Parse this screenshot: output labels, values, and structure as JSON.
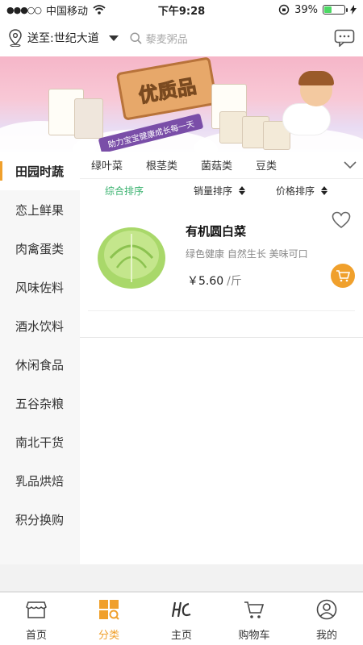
{
  "status_bar": {
    "carrier": "中国移动",
    "time": "下午9:28",
    "battery_pct": "39%",
    "battery_level": 0.39
  },
  "header": {
    "deliver_to": "送至:世纪大道",
    "search_placeholder": "藜麦粥品"
  },
  "banner": {
    "sign_text": "优质品",
    "ribbon_text": "助力宝宝健康成长每一天"
  },
  "categories": [
    {
      "label": "田园时蔬",
      "active": true
    },
    {
      "label": "恋上鲜果"
    },
    {
      "label": "肉禽蛋类"
    },
    {
      "label": "风味佐料"
    },
    {
      "label": "酒水饮料"
    },
    {
      "label": "休闲食品"
    },
    {
      "label": "五谷杂粮"
    },
    {
      "label": "南北干货"
    },
    {
      "label": "乳品烘焙"
    },
    {
      "label": "积分换购"
    }
  ],
  "subtabs": [
    "绿叶菜",
    "根茎类",
    "菌菇类",
    "豆类"
  ],
  "sorts": {
    "default": "综合排序",
    "sales": "销量排序",
    "price": "价格排序"
  },
  "product": {
    "name": "有机圆白菜",
    "desc": "绿色健康 自然生长 美味可口",
    "price": "￥5.60",
    "unit": "/斤"
  },
  "tabbar": [
    {
      "label": "首页",
      "icon": "store-icon"
    },
    {
      "label": "分类",
      "icon": "category-icon",
      "active": true
    },
    {
      "label": "主页",
      "icon": "brand-logo-icon"
    },
    {
      "label": "购物车",
      "icon": "cart-icon"
    },
    {
      "label": "我的",
      "icon": "profile-icon"
    }
  ],
  "colors": {
    "accent": "#f0a02c",
    "sort_active": "#3cb371",
    "battery": "#4cd964"
  }
}
